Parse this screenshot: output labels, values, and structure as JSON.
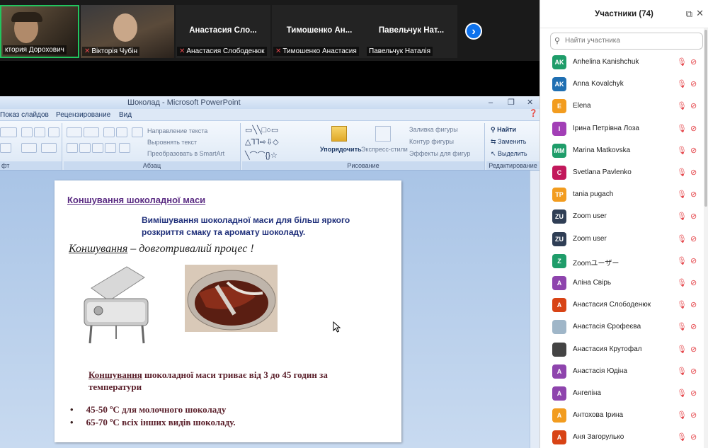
{
  "video": {
    "tiles": [
      {
        "label": "ктория Дорохович",
        "big": ""
      },
      {
        "label": "Вікторія Чубін",
        "big": ""
      },
      {
        "label": "Анастасия Слободенюк",
        "big": "Анастасия  Сло..."
      },
      {
        "label": "Тимошенко Анастасия",
        "big": "Тимошенко  Ан..."
      },
      {
        "label": "Павельчук Наталія",
        "big": "Павельчук  Нат..."
      }
    ],
    "next_icon": "chevron-right-icon"
  },
  "ppt": {
    "window_title": "Шоколад - Microsoft PowerPoint",
    "menu": [
      "Показ слайдов",
      "Рецензирование",
      "Вид"
    ],
    "ribbon": {
      "group_paragraph": "Абзац",
      "group_drawing": "Рисование",
      "group_editing": "Редактирование",
      "group_font_tail": "фт",
      "text_direction": "Направление текста",
      "align_text": "Выровнять текст",
      "smartart": "Преобразовать в SmartArt",
      "arrange": "Упорядочить",
      "quick_styles": "Экспресс-стили",
      "shape_fill": "Заливка фигуры",
      "shape_outline": "Контур фигуры",
      "shape_effects": "Эффекты для фигур",
      "find": "Найти",
      "replace": "Заменить",
      "select": "Выделить"
    },
    "slide": {
      "title": "Коншування шоколадної маси",
      "subtitle": "Вимішування шоколадної маси для більш яркого розкриття смаку та аромату шоколаду.",
      "italic_word": "Коншування",
      "italic_rest": " – довготривалий процес !",
      "body_word": "Коншування",
      "body_rest": " шоколадної маси триває від 3  до 45 годин за температури",
      "bullets": [
        "45-50 ºС для молочного шоколаду",
        "65-70 ºС всіх  інших видів шоколаду."
      ]
    }
  },
  "panel": {
    "title": "Участники (74)",
    "search_placeholder": "Найти участника",
    "participants": [
      {
        "initials": "AK",
        "name": "Anhelina Kanishchuk",
        "color": "#1f9d6a"
      },
      {
        "initials": "AK",
        "name": "Anna Kovalchyk",
        "color": "#1f6fb2"
      },
      {
        "initials": "E",
        "name": "Elena",
        "color": "#f29c1f"
      },
      {
        "initials": "I",
        "name": "Ірина Петрівна Лоза",
        "color": "#a23fb6"
      },
      {
        "initials": "MM",
        "name": "Marina Matkovska",
        "color": "#1f9d6a"
      },
      {
        "initials": "C",
        "name": "Svetlana Pavlenko",
        "color": "#c2185b"
      },
      {
        "initials": "TP",
        "name": "tania pugach",
        "color": "#f29c1f"
      },
      {
        "initials": "ZU",
        "name": "Zoom user",
        "color": "#2f3e55"
      },
      {
        "initials": "ZU",
        "name": "Zoom user",
        "color": "#2f3e55"
      },
      {
        "initials": "Z",
        "name": "Zoomユーザー",
        "color": "#1f9d6a"
      },
      {
        "initials": "A",
        "name": "Аліна Свірь",
        "color": "#8e44ad"
      },
      {
        "initials": "A",
        "name": "Анастасия Слободенюк",
        "color": "#d84315"
      },
      {
        "initials": "",
        "name": "Анастасія Єрофеєва",
        "color": "#9fb6c8"
      },
      {
        "initials": "",
        "name": "Анастасия Крутофал",
        "color": "#444444"
      },
      {
        "initials": "A",
        "name": "Анастасія Юдіна",
        "color": "#8e44ad"
      },
      {
        "initials": "A",
        "name": "Ангеліна",
        "color": "#8e44ad"
      },
      {
        "initials": "A",
        "name": "Антохова Ірина",
        "color": "#f29c1f"
      },
      {
        "initials": "A",
        "name": "Аня Загорулько",
        "color": "#d84315"
      }
    ]
  }
}
